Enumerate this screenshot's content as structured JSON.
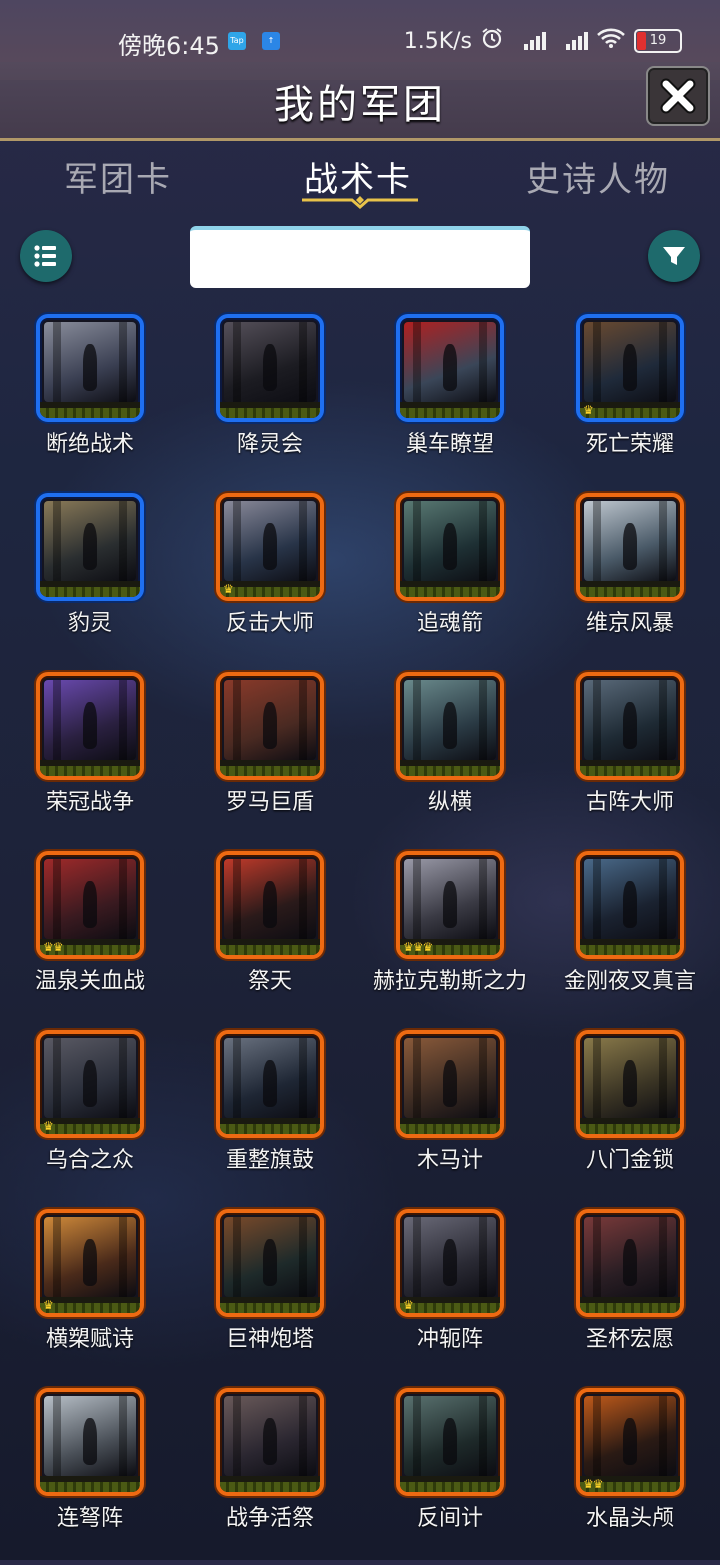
{
  "status_bar": {
    "time": "傍晚6:45",
    "app_badges": [
      {
        "text": "Tap",
        "color": "#2fa5e8"
      },
      {
        "text": "↑",
        "color": "#2b86e6"
      }
    ],
    "network_speed": "1.5K/s",
    "battery_level": "19"
  },
  "header": {
    "title": "我的军团",
    "close_icon": "close-x-icon"
  },
  "tabs": [
    {
      "label": "军团卡",
      "active": false
    },
    {
      "label": "战术卡",
      "active": true
    },
    {
      "label": "史诗人物",
      "active": false
    }
  ],
  "toolbar": {
    "list_icon": "list-icon",
    "filter_icon": "filter-icon",
    "search_value": "",
    "search_placeholder": ""
  },
  "colors": {
    "rare_border": "#1f6ff0",
    "epic_border": "#ee6a12",
    "button_teal": "#1e6a6c",
    "crown": "#ffd52a"
  },
  "cards": [
    {
      "name": "断绝战术",
      "rarity": "blue",
      "crowns": 0,
      "art": [
        "#3a3f52",
        "#8a8e9c"
      ]
    },
    {
      "name": "降灵会",
      "rarity": "blue",
      "crowns": 0,
      "art": [
        "#1c1c22",
        "#55505a"
      ]
    },
    {
      "name": "巢车瞭望",
      "rarity": "blue",
      "crowns": 0,
      "art": [
        "#3a4658",
        "#b02020"
      ]
    },
    {
      "name": "死亡荣耀",
      "rarity": "blue",
      "crowns": 1,
      "art": [
        "#1f2a3a",
        "#6a4a30"
      ]
    },
    {
      "name": "豹灵",
      "rarity": "blue",
      "crowns": 0,
      "art": [
        "#2a2e30",
        "#8a7a58"
      ]
    },
    {
      "name": "反击大师",
      "rarity": "orange",
      "crowns": 1,
      "art": [
        "#283448",
        "#8a8a9a"
      ]
    },
    {
      "name": "追魂箭",
      "rarity": "orange",
      "crowns": 0,
      "art": [
        "#1e3034",
        "#5a7a74"
      ]
    },
    {
      "name": "维京风暴",
      "rarity": "orange",
      "crowns": 0,
      "art": [
        "#4a5a68",
        "#c0c8d0"
      ]
    },
    {
      "name": "荣冠战争",
      "rarity": "orange",
      "crowns": 0,
      "art": [
        "#2a2040",
        "#6a4ab0"
      ]
    },
    {
      "name": "罗马巨盾",
      "rarity": "orange",
      "crowns": 0,
      "art": [
        "#4a2a22",
        "#8a3a2a"
      ]
    },
    {
      "name": "纵横",
      "rarity": "orange",
      "crowns": 0,
      "art": [
        "#2a3a44",
        "#6a8a8c"
      ]
    },
    {
      "name": "古阵大师",
      "rarity": "orange",
      "crowns": 0,
      "art": [
        "#1e2a34",
        "#5a6a7a"
      ]
    },
    {
      "name": "温泉关血战",
      "rarity": "orange",
      "crowns": 2,
      "art": [
        "#3a1a20",
        "#a02a2a"
      ]
    },
    {
      "name": "祭天",
      "rarity": "orange",
      "crowns": 0,
      "art": [
        "#2a1a1a",
        "#c03a2a"
      ]
    },
    {
      "name": "赫拉克勒斯之力",
      "rarity": "orange",
      "crowns": 3,
      "art": [
        "#3a3a44",
        "#9a9aa8"
      ]
    },
    {
      "name": "金刚夜叉真言",
      "rarity": "orange",
      "crowns": 0,
      "art": [
        "#1a2230",
        "#4a6a8a"
      ]
    },
    {
      "name": "乌合之众",
      "rarity": "orange",
      "crowns": 1,
      "art": [
        "#2a2e3a",
        "#5a5a64"
      ]
    },
    {
      "name": "重整旗鼓",
      "rarity": "orange",
      "crowns": 0,
      "art": [
        "#1e2634",
        "#6a7280"
      ]
    },
    {
      "name": "木马计",
      "rarity": "orange",
      "crowns": 0,
      "art": [
        "#3a2a22",
        "#8a5a3a"
      ]
    },
    {
      "name": "八门金锁",
      "rarity": "orange",
      "crowns": 0,
      "art": [
        "#3a3424",
        "#8a7a4a"
      ]
    },
    {
      "name": "横槊赋诗",
      "rarity": "orange",
      "crowns": 1,
      "art": [
        "#4a2a1a",
        "#d08a3a"
      ]
    },
    {
      "name": "巨神炮塔",
      "rarity": "orange",
      "crowns": 0,
      "art": [
        "#1e2a2a",
        "#7a4a2a"
      ]
    },
    {
      "name": "冲轭阵",
      "rarity": "orange",
      "crowns": 1,
      "art": [
        "#2a2a34",
        "#6a6a78"
      ]
    },
    {
      "name": "圣杯宏愿",
      "rarity": "orange",
      "crowns": 0,
      "art": [
        "#2a1e24",
        "#7a3a3a"
      ]
    },
    {
      "name": "连弩阵",
      "rarity": "orange",
      "crowns": 0,
      "art": [
        "#4a5058",
        "#b8c0c8"
      ]
    },
    {
      "name": "战争活祭",
      "rarity": "orange",
      "crowns": 0,
      "art": [
        "#2a2630",
        "#6a5a5a"
      ]
    },
    {
      "name": "反间计",
      "rarity": "orange",
      "crowns": 0,
      "art": [
        "#1e2a2a",
        "#5a7270"
      ]
    },
    {
      "name": "水晶头颅",
      "rarity": "orange",
      "crowns": 2,
      "art": [
        "#2a1a14",
        "#c05a1a"
      ]
    }
  ]
}
